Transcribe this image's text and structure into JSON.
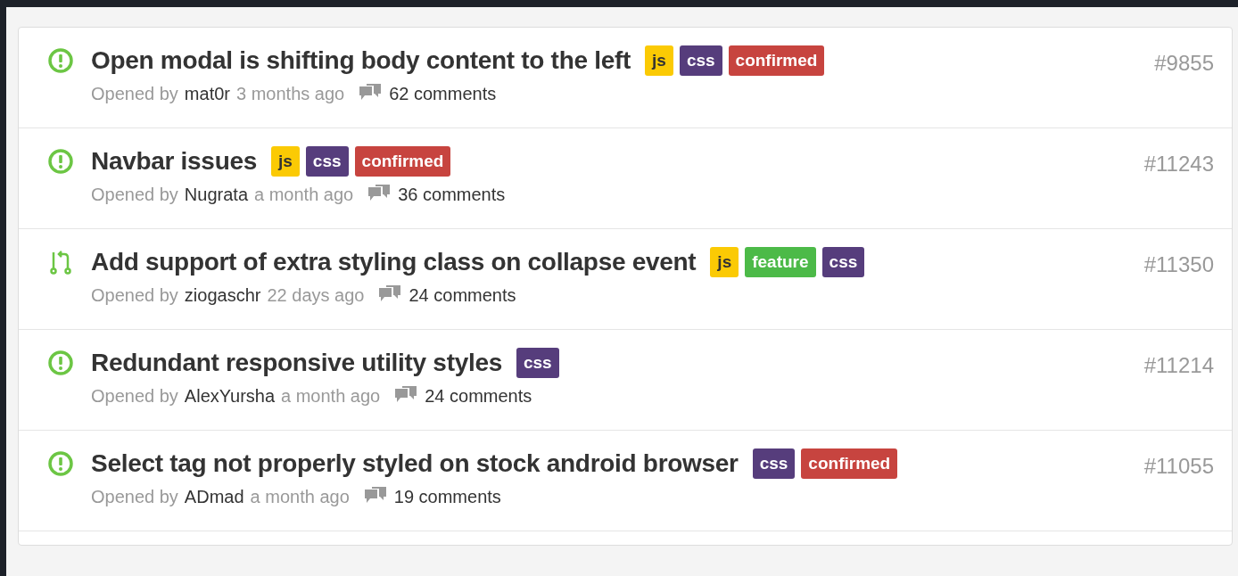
{
  "issues": [
    {
      "kind": "issue",
      "title": "Open modal is shifting body content to the left",
      "labels": [
        {
          "text": "js",
          "color": "#fbca04"
        },
        {
          "text": "css",
          "color": "#563d7c"
        },
        {
          "text": "confirmed",
          "color": "#c7443f"
        }
      ],
      "number": "#9855",
      "opened_by": "Opened by",
      "author": "mat0r",
      "age": "3 months ago",
      "comments": "62 comments"
    },
    {
      "kind": "issue",
      "title": "Navbar issues",
      "labels": [
        {
          "text": "js",
          "color": "#fbca04"
        },
        {
          "text": "css",
          "color": "#563d7c"
        },
        {
          "text": "confirmed",
          "color": "#c7443f"
        }
      ],
      "number": "#11243",
      "opened_by": "Opened by",
      "author": "Nugrata",
      "age": "a month ago",
      "comments": "36 comments"
    },
    {
      "kind": "pull",
      "title": "Add support of extra styling class on collapse event",
      "labels": [
        {
          "text": "js",
          "color": "#fbca04"
        },
        {
          "text": "feature",
          "color": "#4cba48"
        },
        {
          "text": "css",
          "color": "#563d7c"
        }
      ],
      "number": "#11350",
      "opened_by": "Opened by",
      "author": "ziogaschr",
      "age": "22 days ago",
      "comments": "24 comments"
    },
    {
      "kind": "issue",
      "title": "Redundant responsive utility styles",
      "labels": [
        {
          "text": "css",
          "color": "#563d7c"
        }
      ],
      "number": "#11214",
      "opened_by": "Opened by",
      "author": "AlexYursha",
      "age": "a month ago",
      "comments": "24 comments"
    },
    {
      "kind": "issue",
      "title": "Select tag not properly styled on stock android browser",
      "labels": [
        {
          "text": "css",
          "color": "#563d7c"
        },
        {
          "text": "confirmed",
          "color": "#c7443f"
        }
      ],
      "number": "#11055",
      "opened_by": "Opened by",
      "author": "ADmad",
      "age": "a month ago",
      "comments": "19 comments"
    }
  ]
}
